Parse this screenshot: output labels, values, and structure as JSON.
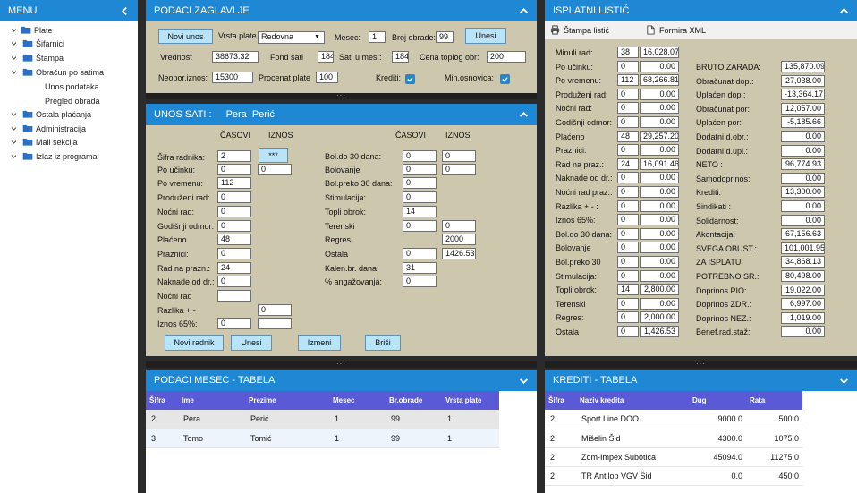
{
  "menu": {
    "title": "MENU",
    "items": [
      {
        "label": "Plate"
      },
      {
        "label": "Šifarnici"
      },
      {
        "label": "Štampa"
      },
      {
        "label": "Obračun po satima"
      },
      {
        "label": "Unos podataka"
      },
      {
        "label": "Pregled obrada"
      },
      {
        "label": "Ostala plaćanja"
      },
      {
        "label": "Administracija"
      },
      {
        "label": "Mail sekcija"
      },
      {
        "label": "Izlaz iz programa"
      }
    ]
  },
  "zaglavlje": {
    "title": "PODACI ZAGLAVLJE",
    "novi_unos": "Novi unos",
    "vrsta_plate_label": "Vrsta plate",
    "vrsta_plate_value": "Redovna",
    "mesec_label": "Mesec:",
    "mesec_value": "1",
    "broj_obrade_label": "Broj obrade:",
    "broj_obrade_value": "99",
    "unesi": "Unesi",
    "vrednost_label": "Vrednost",
    "vrednost_value": "38673.32",
    "fond_sati_label": "Fond sati",
    "fond_sati_value": "184",
    "sati_u_mes_label": "Sati u mes.:",
    "sati_u_mes_value": "184",
    "cena_toplog_label": "Cena toplog obr:",
    "cena_toplog_value": "200",
    "neopor_label": "Neopor.iznos:",
    "neopor_value": "15300",
    "procenat_label": "Procenat plate",
    "procenat_value": "100",
    "krediti_label": "Krediti:",
    "min_osn_label": "Min.osnovica:"
  },
  "unos_sati": {
    "title": "UNOS SATI :",
    "ime": "Pera",
    "prezime": "Perić",
    "col_casovi": "ČASOVI",
    "col_iznos": "IZNOS",
    "sifra_label": "Šifra radnika:",
    "sifra_value": "2",
    "sifra_btn": "***",
    "left_rows": [
      {
        "label": "Po učinku:",
        "casovi": "0",
        "iznos": "0"
      },
      {
        "label": "Po vremenu:",
        "casovi": "112",
        "iznos": null
      },
      {
        "label": "Produženi rad:",
        "casovi": "0",
        "iznos": null
      },
      {
        "label": "Noćni rad:",
        "casovi": "0",
        "iznos": null
      },
      {
        "label": "Godišnji odmor:",
        "casovi": "0",
        "iznos": null
      },
      {
        "label": "Plaćeno",
        "casovi": "48",
        "iznos": null
      },
      {
        "label": "Praznici:",
        "casovi": "0",
        "iznos": null
      },
      {
        "label": "Rad na prazn.:",
        "casovi": "24",
        "iznos": null
      },
      {
        "label": "Naknade od dr.:",
        "casovi": "0",
        "iznos": null
      },
      {
        "label": "Noćni rad",
        "casovi": "",
        "iznos": null
      },
      {
        "label": "Razlika + - :",
        "casovi": null,
        "iznos": "0"
      },
      {
        "label": "Iznos 65%:",
        "casovi": "0",
        "iznos": ""
      }
    ],
    "right_rows": [
      {
        "label": "Bol.do 30 dana:",
        "casovi": "0",
        "iznos": "0"
      },
      {
        "label": "Bolovanje",
        "casovi": "0",
        "iznos": "0"
      },
      {
        "label": "Bol.preko 30 dana:",
        "casovi": "0",
        "iznos": null
      },
      {
        "label": "Stimulacija:",
        "casovi": "0",
        "iznos": null
      },
      {
        "label": "Topli obrok:",
        "casovi": "14",
        "iznos": null
      },
      {
        "label": "Terenski",
        "casovi": "0",
        "iznos": "0"
      },
      {
        "label": "Regres:",
        "casovi": null,
        "iznos": "2000"
      },
      {
        "label": "Ostala",
        "casovi": "0",
        "iznos": "1426.53"
      },
      {
        "label": "Kalen.br. dana:",
        "casovi": "31",
        "iznos": null
      },
      {
        "label": "% angažovanja:",
        "casovi": "0",
        "iznos": null
      }
    ],
    "buttons": {
      "novi_radnik": "Novi radnik",
      "unesi": "Unesi",
      "izmeni": "Izmeni",
      "brisi": "Briši"
    }
  },
  "isplatni": {
    "title": "ISPLATNI LISTIĆ",
    "stampa": "Štampa listić",
    "formira_xml": "Formira XML",
    "left_rows": [
      {
        "label": "Minuli rad:",
        "a": "38",
        "b": "16,028.07"
      },
      {
        "label": "Po učinku:",
        "a": "0",
        "b": "0.00"
      },
      {
        "label": "Po vremenu:",
        "a": "112",
        "b": "68,266.81"
      },
      {
        "label": "Produženi rad:",
        "a": "0",
        "b": "0.00"
      },
      {
        "label": "Noćni rad:",
        "a": "0",
        "b": "0.00"
      },
      {
        "label": "Godišnji odmor:",
        "a": "0",
        "b": "0.00"
      },
      {
        "label": "Plaćeno",
        "a": "48",
        "b": "29,257.20"
      },
      {
        "label": "Praznici:",
        "a": "0",
        "b": "0.00"
      },
      {
        "label": "Rad na praz.:",
        "a": "24",
        "b": "16,091.46"
      },
      {
        "label": "Naknade od dr.:",
        "a": "0",
        "b": "0.00"
      },
      {
        "label": "Noćni rad praz.:",
        "a": "0",
        "b": "0.00"
      },
      {
        "label": "Razlika + - :",
        "a": "0",
        "b": "0.00"
      },
      {
        "label": "Iznos 65%:",
        "a": "0",
        "b": "0.00"
      },
      {
        "label": "Bol.do 30 dana:",
        "a": "0",
        "b": "0.00"
      },
      {
        "label": "Bolovanje",
        "a": "0",
        "b": "0.00"
      },
      {
        "label": "Bol.preko 30",
        "a": "0",
        "b": "0.00"
      },
      {
        "label": "Stimulacija:",
        "a": "0",
        "b": "0.00"
      },
      {
        "label": "Topli obrok:",
        "a": "14",
        "b": "2,800.00"
      },
      {
        "label": "Terenski",
        "a": "0",
        "b": "0.00"
      },
      {
        "label": "Regres:",
        "a": "0",
        "b": "2,000.00"
      },
      {
        "label": "Ostala",
        "a": "0",
        "b": "1,426.53"
      }
    ],
    "right_rows": [
      {
        "label": "BRUTO ZARADA:",
        "v": "135,870.09"
      },
      {
        "label": "Obračunat dop.:",
        "v": "27,038.00"
      },
      {
        "label": "Uplaćen dop.:",
        "v": "-13,364.17"
      },
      {
        "label": "Obračunat por:",
        "v": "12,057.00"
      },
      {
        "label": "Uplaćen por:",
        "v": "-5,185.66"
      },
      {
        "label": "Dodatni d.obr.:",
        "v": "0.00"
      },
      {
        "label": "Dodatni d.upl.:",
        "v": "0.00"
      },
      {
        "label": "NETO :",
        "v": "96,774.93"
      },
      {
        "label": "Samodoprinos:",
        "v": "0.00"
      },
      {
        "label": "Krediti:",
        "v": "13,300.00"
      },
      {
        "label": "Sindikati :",
        "v": "0.00"
      },
      {
        "label": "Solidarnost:",
        "v": "0.00"
      },
      {
        "label": "Akontacija:",
        "v": "67,156.63"
      },
      {
        "label": "SVEGA OBUST.:",
        "v": "101,001.95"
      },
      {
        "label": "ZA ISPLATU:",
        "v": "34,868.13"
      },
      {
        "label": "POTREBNO SR.:",
        "v": "80,498.00"
      },
      {
        "label": "Doprinos PIO:",
        "v": "19,022.00"
      },
      {
        "label": "Doprinos ZDR.:",
        "v": "6,997.00"
      },
      {
        "label": "Doprinos NEZ.:",
        "v": "1,019.00"
      },
      {
        "label": "Benef.rad.staž:",
        "v": "0.00"
      }
    ]
  },
  "mesec_tabela": {
    "title": "PODACI MESEC - TABELA",
    "columns": [
      "Šifra",
      "Ime",
      "Prezime",
      "Mesec",
      "Br.obrade",
      "Vrsta plate"
    ],
    "rows": [
      [
        "2",
        "Pera",
        "Perić",
        "1",
        "99",
        "1"
      ],
      [
        "3",
        "Tomo",
        "Tomić",
        "1",
        "99",
        "1"
      ]
    ]
  },
  "krediti_tabela": {
    "title": "KREDITI - TABELA",
    "columns": [
      "Šifra",
      "Naziv kredita",
      "Dug",
      "Rata"
    ],
    "rows": [
      [
        "2",
        "Sport Line DOO",
        "9000.0",
        "500.0"
      ],
      [
        "2",
        "Mišelin Šid",
        "4300.0",
        "1075.0"
      ],
      [
        "2",
        "Zom-Impex Subotica",
        "45094.0",
        "11275.0"
      ],
      [
        "2",
        "TR Antilop VGV Šid",
        "0.0",
        "450.0"
      ]
    ]
  },
  "colors": {
    "header": "#1e88d4",
    "panel": "#cdc7ad",
    "button": "#b9e3f7",
    "table_header": "#5a5ad6"
  }
}
